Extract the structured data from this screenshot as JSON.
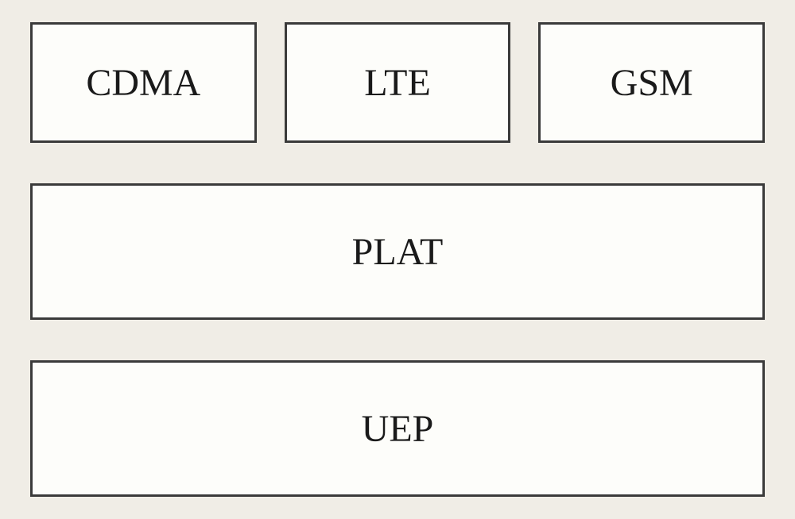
{
  "diagram": {
    "top_row": {
      "box1": "CDMA",
      "box2": "LTE",
      "box3": "GSM"
    },
    "middle_box": "PLAT",
    "bottom_box": "UEP"
  }
}
